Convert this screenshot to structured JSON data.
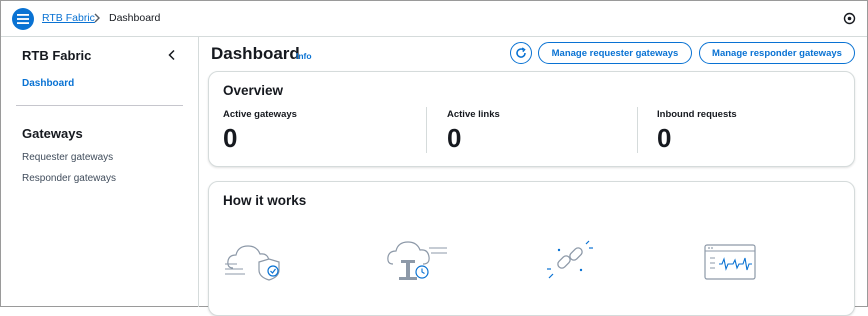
{
  "breadcrumb": {
    "root": "RTB Fabric",
    "current": "Dashboard"
  },
  "sidebar": {
    "title": "RTB Fabric",
    "items": [
      {
        "label": "Dashboard",
        "active": true
      }
    ],
    "section_title": "Gateways",
    "gateway_items": [
      {
        "label": "Requester gateways"
      },
      {
        "label": "Responder gateways"
      }
    ]
  },
  "header": {
    "title": "Dashboard",
    "info": "Info",
    "buttons": {
      "manage_requester": "Manage requester gateways",
      "manage_responder": "Manage responder gateways"
    }
  },
  "overview": {
    "title": "Overview",
    "metrics": [
      {
        "label": "Active gateways",
        "value": "0"
      },
      {
        "label": "Active links",
        "value": "0"
      },
      {
        "label": "Inbound requests",
        "value": "0"
      }
    ]
  },
  "how_it_works": {
    "title": "How it works",
    "icons": [
      "cloud-shield-icon",
      "cloud-server-clock-icon",
      "link-chain-icon",
      "browser-waveform-icon"
    ]
  },
  "colors": {
    "accent": "#0972d3",
    "text": "#16191f",
    "border": "#d5dbdb"
  }
}
